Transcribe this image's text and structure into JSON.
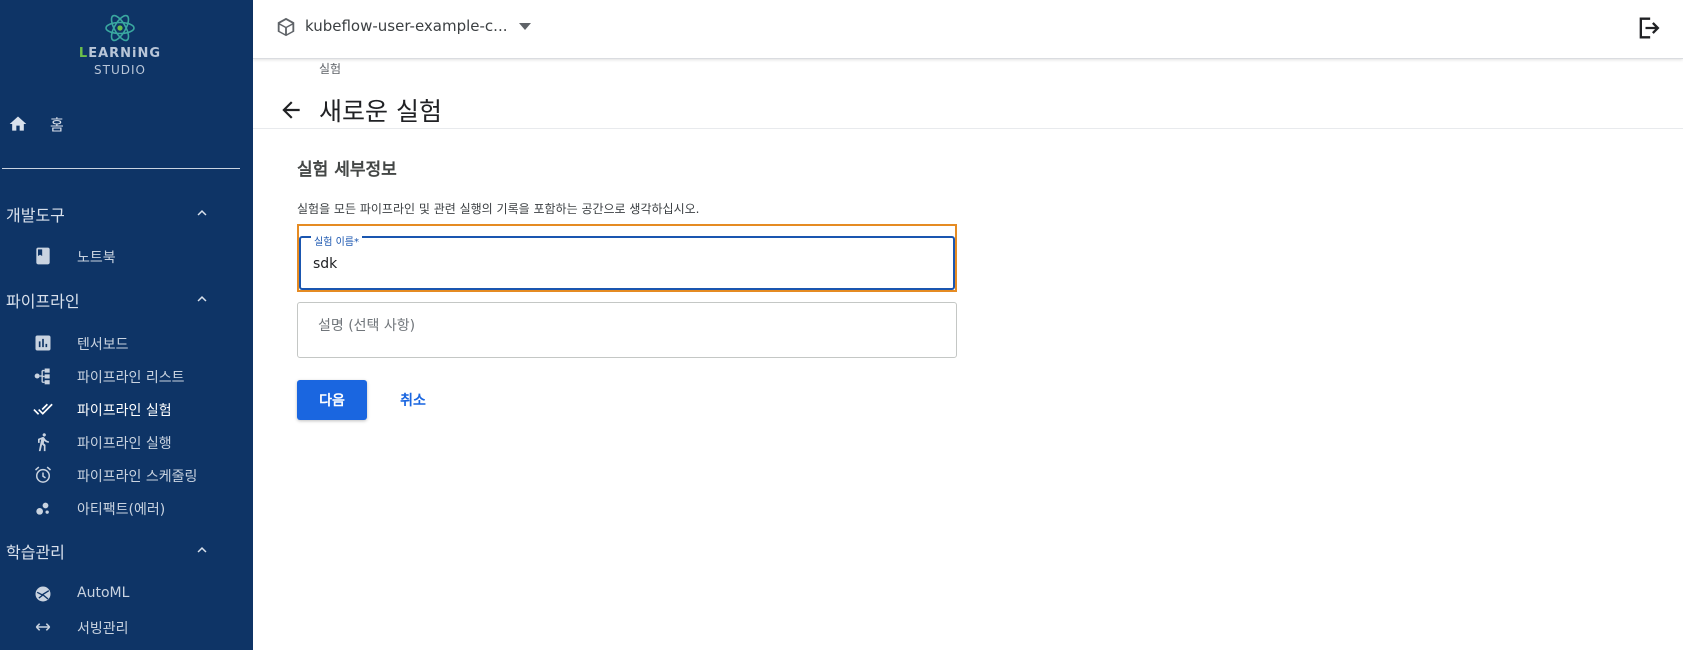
{
  "colors": {
    "sidebar_bg": "#0e3466",
    "primary": "#1a66e0",
    "focus_outline": "#e58b23",
    "field_focus": "#1a56b0",
    "logo_accent": "#6cc04a"
  },
  "sidebar": {
    "logo": {
      "line1_accent": "L",
      "line1_rest": "EARNiNG",
      "line2": "STUDIO",
      "icon": "atom-icon"
    },
    "home": {
      "label": "홈",
      "icon": "home-icon"
    },
    "sections": [
      {
        "label": "개발도구",
        "items": [
          {
            "label": "노트북",
            "icon": "book-icon"
          }
        ]
      },
      {
        "label": "파이프라인",
        "items": [
          {
            "label": "텐서보드",
            "icon": "chart-icon"
          },
          {
            "label": "파이프라인 리스트",
            "icon": "pipeline-icon"
          },
          {
            "label": "파이프라인 실험",
            "icon": "done-all-icon",
            "active": true
          },
          {
            "label": "파이프라인 실행",
            "icon": "run-icon"
          },
          {
            "label": "파이프라인 스케줄링",
            "icon": "alarm-icon"
          },
          {
            "label": "아티팩트(에러)",
            "icon": "bubbles-icon"
          }
        ]
      },
      {
        "label": "학습관리",
        "items": [
          {
            "label": "AutoML",
            "icon": "automl-icon"
          },
          {
            "label": "서빙관리",
            "icon": "arrows-icon"
          }
        ]
      }
    ]
  },
  "topbar": {
    "namespace": "kubeflow-user-example-c...",
    "namespace_icon": "cube-icon",
    "dropdown_icon": "caret-down-icon",
    "logout_icon": "logout-icon"
  },
  "header": {
    "breadcrumb": "실험",
    "title": "새로운 실험",
    "back_icon": "arrow-back-icon"
  },
  "form": {
    "section_title": "실험 세부정보",
    "description": "실험을 모든 파이프라인 및 관련 실행의 기록을 포함하는 공간으로 생각하십시오.",
    "name_label": "실험 이름*",
    "name_value": "sdk",
    "desc_placeholder": "설명 (선택 사항)",
    "desc_value": "",
    "next_label": "다음",
    "cancel_label": "취소"
  }
}
